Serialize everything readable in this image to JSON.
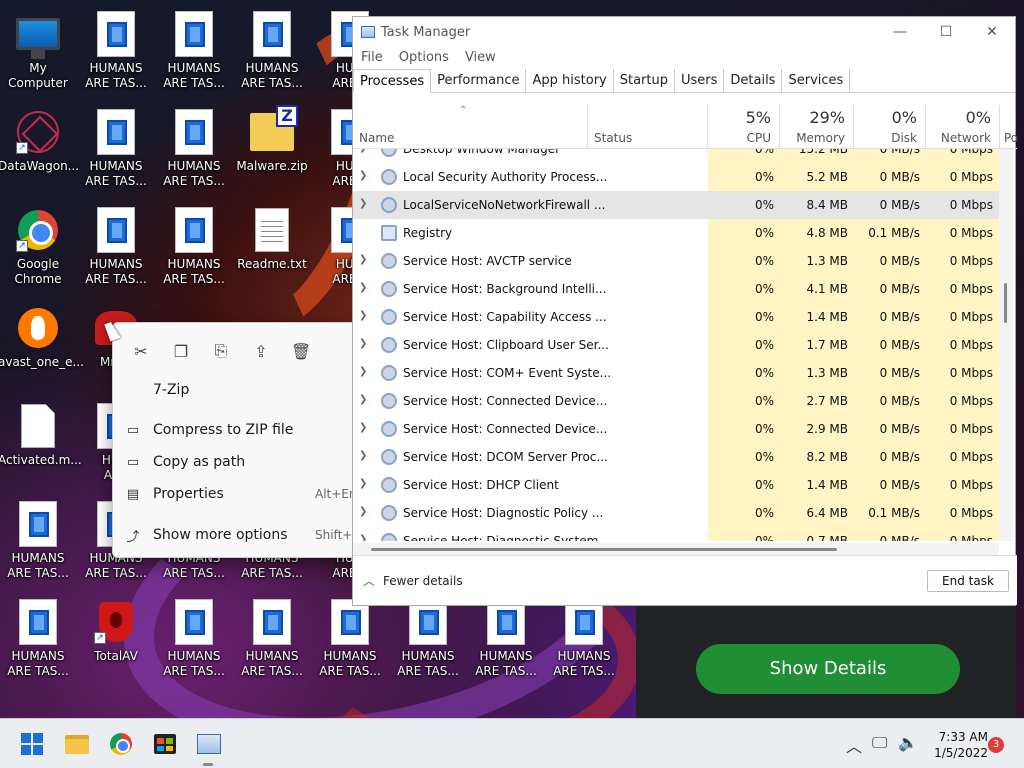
{
  "desktop": {
    "icons": [
      {
        "label": "My Computer",
        "kind": "monitor"
      },
      {
        "label": "HUMANS\nARE TAS...",
        "kind": "doc"
      },
      {
        "label": "HUMANS\nARE TAS...",
        "kind": "doc"
      },
      {
        "label": "HUMANS\nARE TAS...",
        "kind": "doc"
      },
      {
        "label": "HUM\nARE T",
        "kind": "doc"
      },
      {
        "label": "DataWagon...",
        "kind": "spider"
      },
      {
        "label": "HUMANS\nARE TAS...",
        "kind": "doc"
      },
      {
        "label": "HUMANS\nARE TAS...",
        "kind": "doc"
      },
      {
        "label": "Malware.zip",
        "kind": "zip"
      },
      {
        "label": "HUM\nARE T",
        "kind": "doc"
      },
      {
        "label": "Google\nChrome",
        "kind": "chrome"
      },
      {
        "label": "HUMANS\nARE TAS...",
        "kind": "doc"
      },
      {
        "label": "HUMANS\nARE TAS...",
        "kind": "doc"
      },
      {
        "label": "Readme.txt",
        "kind": "txt"
      },
      {
        "label": "HUM\nARE T",
        "kind": "doc"
      },
      {
        "label": "avast_one_e...",
        "kind": "avast"
      },
      {
        "label": "MrsM",
        "kind": "mrs"
      },
      {
        "label": "Activated.m...",
        "kind": "blank"
      },
      {
        "label": "HUM\nARE",
        "kind": "doc"
      },
      {
        "label": "HUMANS\nARE TAS...",
        "kind": "doc"
      },
      {
        "label": "HUMANS\nARE TAS...",
        "kind": "doc"
      },
      {
        "label": "HUMANS\nARE TAS...",
        "kind": "doc"
      },
      {
        "label": "HUMANS\nARE TAS...",
        "kind": "doc"
      },
      {
        "label": "HUM\nARE T",
        "kind": "doc"
      },
      {
        "label": "HUMANS\nARE TAS...",
        "kind": "doc"
      },
      {
        "label": "TotalAV",
        "kind": "shield"
      },
      {
        "label": "HUMANS\nARE TAS...",
        "kind": "doc"
      },
      {
        "label": "HUMANS\nARE TAS...",
        "kind": "doc"
      },
      {
        "label": "HUMANS\nARE TAS...",
        "kind": "doc"
      },
      {
        "label": "HUMANS\nARE TAS...",
        "kind": "doc"
      },
      {
        "label": "HUMANS\nARE TAS...",
        "kind": "doc"
      },
      {
        "label": "HUMANS\nARE TAS...",
        "kind": "doc"
      }
    ]
  },
  "context_menu": {
    "tools": [
      "cut-icon",
      "copy-icon",
      "rename-icon",
      "share-icon",
      "delete-icon"
    ],
    "items": [
      {
        "label": "7-Zip",
        "icon": "",
        "shortcut": ""
      },
      {
        "label": "Compress to ZIP file",
        "icon": "zip-icon",
        "shortcut": ""
      },
      {
        "label": "Copy as path",
        "icon": "path-icon",
        "shortcut": ""
      },
      {
        "label": "Properties",
        "icon": "properties-icon",
        "shortcut": "Alt+Ent"
      },
      {
        "label": "Show more options",
        "icon": "more-options-icon",
        "shortcut": "Shift+F"
      }
    ]
  },
  "task_manager": {
    "title": "Task Manager",
    "menu": [
      "File",
      "Options",
      "View"
    ],
    "tabs": [
      "Processes",
      "Performance",
      "App history",
      "Startup",
      "Users",
      "Details",
      "Services"
    ],
    "active_tab": "Processes",
    "columns": {
      "name": "Name",
      "status": "Status",
      "cpu": {
        "pct": "5%",
        "label": "CPU"
      },
      "memory": {
        "pct": "29%",
        "label": "Memory"
      },
      "disk": {
        "pct": "0%",
        "label": "Disk"
      },
      "network": {
        "pct": "0%",
        "label": "Network"
      },
      "power": "Po"
    },
    "rows": [
      {
        "name": "Desktop Window Manager",
        "expand": true,
        "cpu": "0%",
        "mem": "15.2 MB",
        "disk": "0 MB/s",
        "net": "0 Mbps",
        "partial": true
      },
      {
        "name": "Local Security Authority Process...",
        "expand": true,
        "cpu": "0%",
        "mem": "5.2 MB",
        "disk": "0 MB/s",
        "net": "0 Mbps"
      },
      {
        "name": "LocalServiceNoNetworkFirewall ...",
        "expand": true,
        "cpu": "0%",
        "mem": "8.4 MB",
        "disk": "0 MB/s",
        "net": "0 Mbps",
        "selected": true
      },
      {
        "name": "Registry",
        "expand": false,
        "cpu": "0%",
        "mem": "4.8 MB",
        "disk": "0.1 MB/s",
        "net": "0 Mbps"
      },
      {
        "name": "Service Host: AVCTP service",
        "expand": true,
        "cpu": "0%",
        "mem": "1.3 MB",
        "disk": "0 MB/s",
        "net": "0 Mbps"
      },
      {
        "name": "Service Host: Background Intelli...",
        "expand": true,
        "cpu": "0%",
        "mem": "4.1 MB",
        "disk": "0 MB/s",
        "net": "0 Mbps"
      },
      {
        "name": "Service Host: Capability Access ...",
        "expand": true,
        "cpu": "0%",
        "mem": "1.4 MB",
        "disk": "0 MB/s",
        "net": "0 Mbps"
      },
      {
        "name": "Service Host: Clipboard User Ser...",
        "expand": true,
        "cpu": "0%",
        "mem": "1.7 MB",
        "disk": "0 MB/s",
        "net": "0 Mbps"
      },
      {
        "name": "Service Host: COM+ Event Syste...",
        "expand": true,
        "cpu": "0%",
        "mem": "1.3 MB",
        "disk": "0 MB/s",
        "net": "0 Mbps"
      },
      {
        "name": "Service Host: Connected Device...",
        "expand": true,
        "cpu": "0%",
        "mem": "2.7 MB",
        "disk": "0 MB/s",
        "net": "0 Mbps"
      },
      {
        "name": "Service Host: Connected Device...",
        "expand": true,
        "cpu": "0%",
        "mem": "2.9 MB",
        "disk": "0 MB/s",
        "net": "0 Mbps"
      },
      {
        "name": "Service Host: DCOM Server Proc...",
        "expand": true,
        "cpu": "0%",
        "mem": "8.2 MB",
        "disk": "0 MB/s",
        "net": "0 Mbps"
      },
      {
        "name": "Service Host: DHCP Client",
        "expand": true,
        "cpu": "0%",
        "mem": "1.4 MB",
        "disk": "0 MB/s",
        "net": "0 Mbps"
      },
      {
        "name": "Service Host: Diagnostic Policy ...",
        "expand": true,
        "cpu": "0%",
        "mem": "6.4 MB",
        "disk": "0.1 MB/s",
        "net": "0 Mbps"
      },
      {
        "name": "Service Host: Diagnostic System...",
        "expand": true,
        "cpu": "0%",
        "mem": "0.7 MB",
        "disk": "0 MB/s",
        "net": "0 Mbps",
        "partial": true
      }
    ],
    "fewer_details": "Fewer details",
    "end_task": "End task"
  },
  "overlay": {
    "show_details": "Show Details"
  },
  "taskbar": {
    "apps": [
      "start-icon",
      "file-explorer-icon",
      "chrome-icon",
      "store-icon",
      "task-manager-icon"
    ],
    "time": "7:33 AM",
    "date": "1/5/2022",
    "notifications": "3"
  },
  "colors": {
    "accent": "#1a6fd8",
    "heat": "#fff4c4",
    "show_details": "#1f8e34"
  }
}
